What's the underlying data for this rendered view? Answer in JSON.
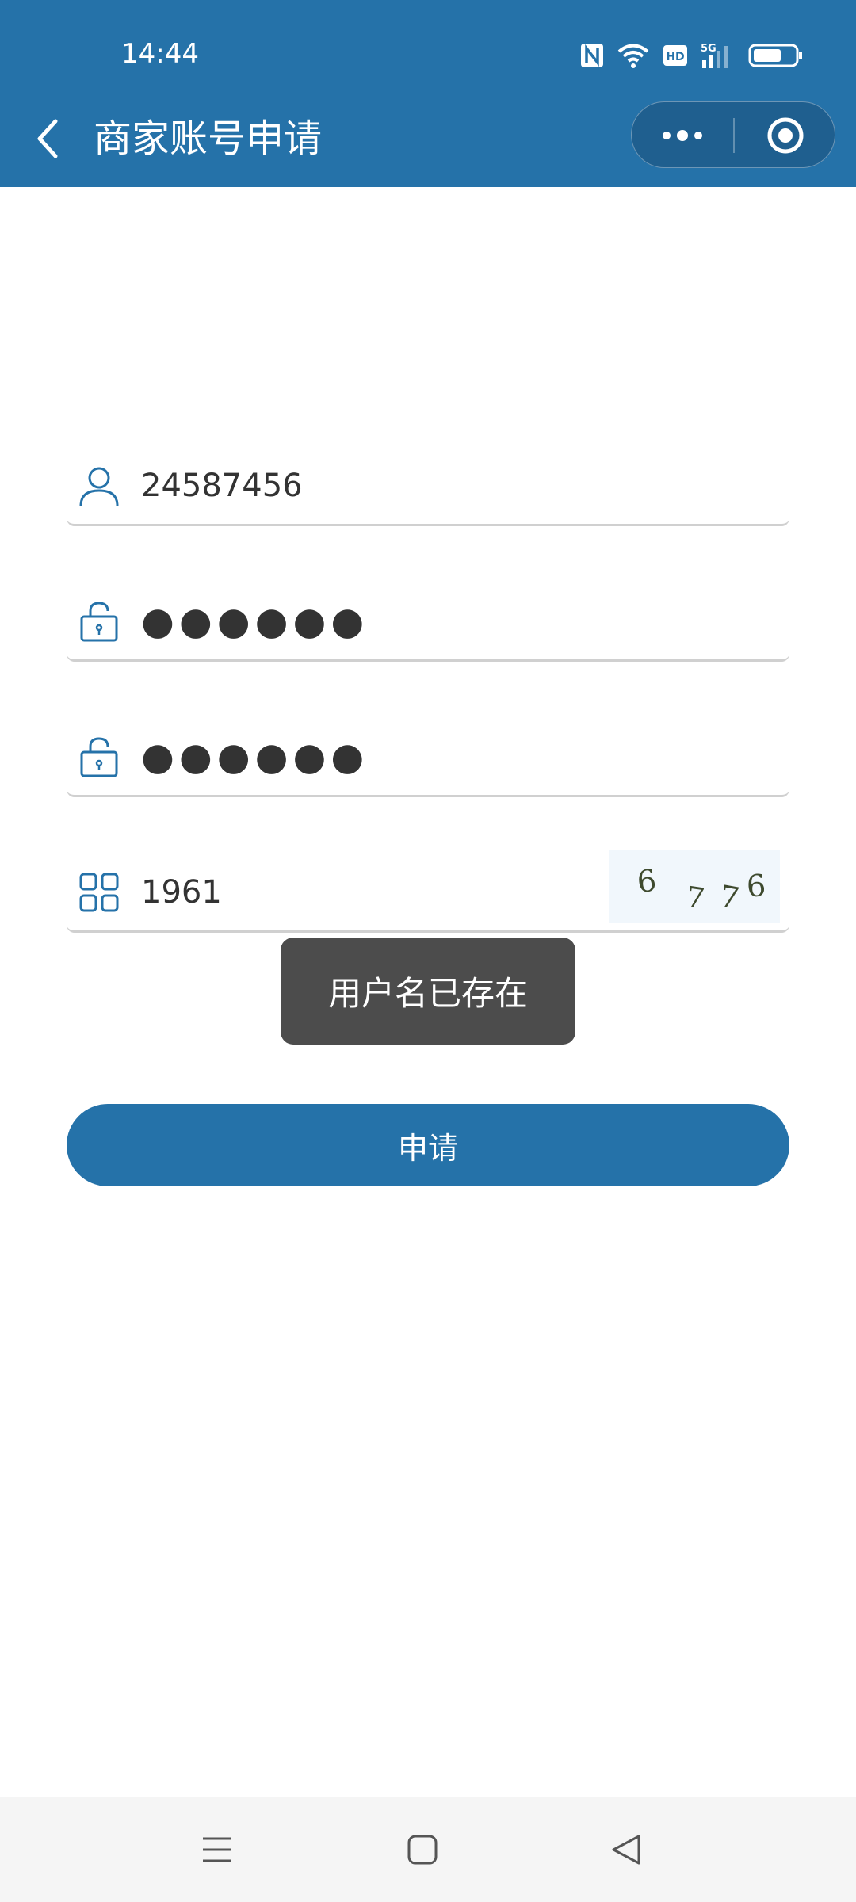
{
  "status_bar": {
    "time": "14:44"
  },
  "nav": {
    "title": "商家账号申请",
    "back_icon": "chevron-left-icon",
    "more_icon": "more-dots-icon",
    "close_icon": "target-circle-icon"
  },
  "form": {
    "username": {
      "value": "24587456",
      "icon": "user-icon"
    },
    "password": {
      "value": "●●●●●●",
      "icon": "lock-icon"
    },
    "confirm_password": {
      "value": "●●●●●●",
      "icon": "lock-icon"
    },
    "captcha": {
      "value": "1961",
      "icon": "grid-icon",
      "image_text": "6776"
    }
  },
  "toast": {
    "message": "用户名已存在"
  },
  "submit": {
    "label": "申请"
  },
  "colors": {
    "primary": "#2572a9",
    "toast_bg": "#4c4c4c"
  },
  "system_nav": {
    "menu_icon": "menu-icon",
    "home_icon": "home-square-icon",
    "back_icon": "back-triangle-icon"
  }
}
